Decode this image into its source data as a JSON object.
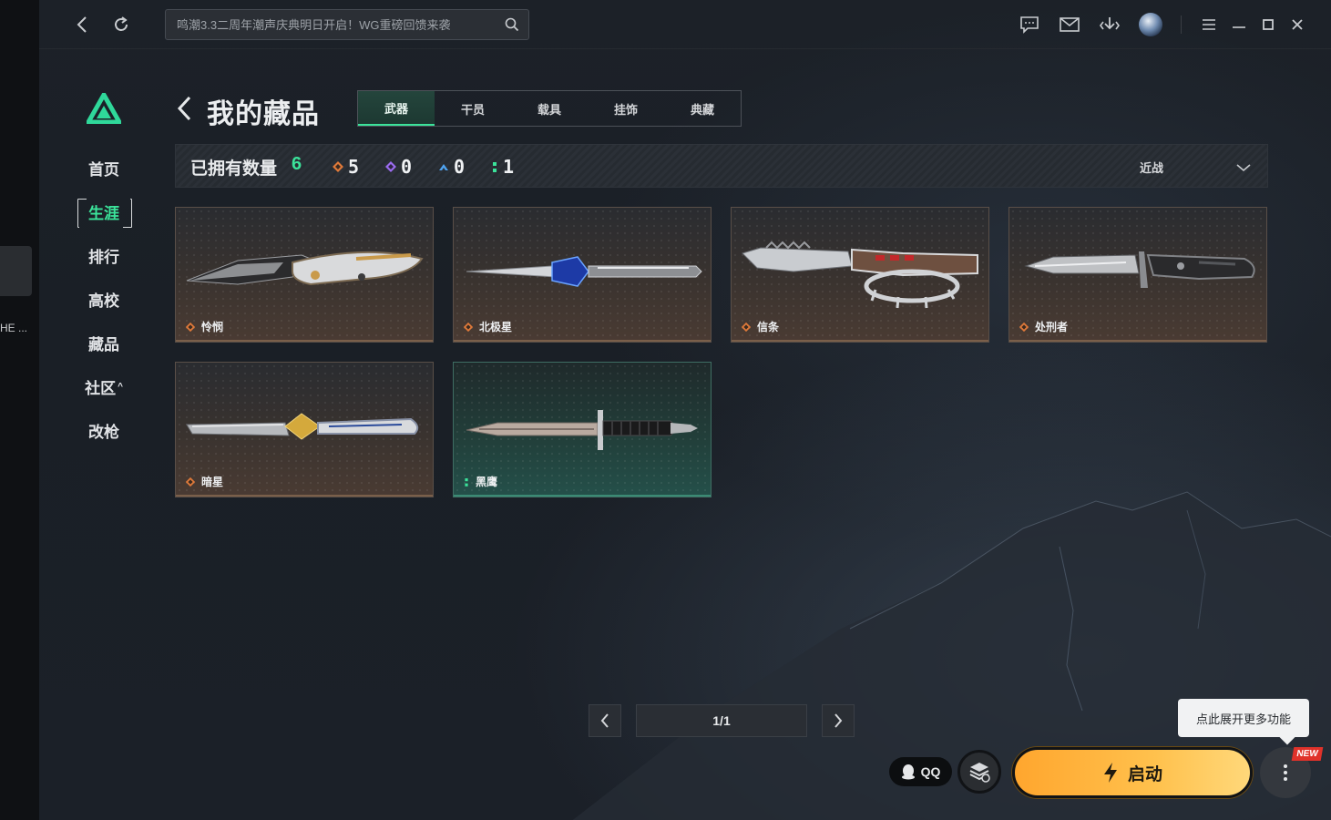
{
  "left_strip": {
    "cut_text": "HE ..."
  },
  "topbar": {
    "search_placeholder": "鸣潮3.3二周年潮声庆典明日开启！WG重磅回馈来袭",
    "icons": [
      "back-icon",
      "refresh-icon",
      "search-icon",
      "chat-icon",
      "mail-icon",
      "download-icon",
      "avatar",
      "menu-icon",
      "minimize-icon",
      "maximize-icon",
      "close-icon"
    ]
  },
  "sidebar": {
    "items": [
      {
        "label": "首页",
        "active": false
      },
      {
        "label": "生涯",
        "active": true
      },
      {
        "label": "排行",
        "active": false
      },
      {
        "label": "高校",
        "active": false
      },
      {
        "label": "藏品",
        "active": false
      },
      {
        "label": "社区",
        "active": false,
        "caret": "^"
      },
      {
        "label": "改枪",
        "active": false
      }
    ]
  },
  "header": {
    "title": "我的藏品",
    "tabs": [
      "武器",
      "干员",
      "载具",
      "挂饰",
      "典藏"
    ],
    "active_tab": 0
  },
  "stats": {
    "owned_label": "已拥有数量",
    "owned_count": "6",
    "rarities": [
      {
        "icon": "orange-diamond-icon",
        "color": "#e07a3a",
        "count": "5"
      },
      {
        "icon": "purple-diamond-icon",
        "color": "#9b6cf0",
        "count": "0"
      },
      {
        "icon": "blue-chevron-icon",
        "color": "#4fa3f0",
        "count": "0"
      },
      {
        "icon": "green-dots-icon",
        "color": "#3be39a",
        "count": "1"
      }
    ],
    "filter_label": "近战"
  },
  "items": [
    {
      "name": "怜悯",
      "rarity": "orange"
    },
    {
      "name": "北极星",
      "rarity": "orange"
    },
    {
      "name": "信条",
      "rarity": "orange"
    },
    {
      "name": "处刑者",
      "rarity": "orange"
    },
    {
      "name": "暗星",
      "rarity": "orange"
    },
    {
      "name": "黑鹰",
      "rarity": "green"
    }
  ],
  "pager": {
    "indicator": "1/1"
  },
  "bottom": {
    "tooltip": "点此展开更多功能",
    "qq_label": "QQ",
    "launch_label": "启动",
    "new_badge": "NEW"
  },
  "colors": {
    "accent_green": "#3be39a",
    "launch_orange": "#ffa62e",
    "rarity_orange": "#e07a3a"
  }
}
